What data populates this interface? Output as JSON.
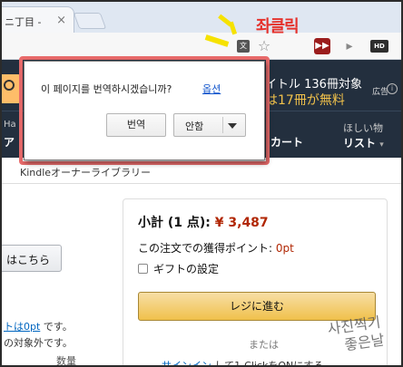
{
  "browser": {
    "tab_title": "ニ丁目 -",
    "tab_close": "×"
  },
  "annotation": {
    "label": "좌클릭"
  },
  "toolbar": {
    "translate_icon_glyph": "文",
    "star_glyph": "☆",
    "ext_glyph": "▶▶",
    "cursor_glyph": "▸",
    "hd_label": "HD"
  },
  "translate_popup": {
    "message": "이 페이지를 번역하시겠습니까?",
    "options_link": "옵션",
    "translate_button": "번역",
    "decline_button": "안함"
  },
  "amazon_header": {
    "promo_line1": "イトル 136冊対象",
    "promo_line2": "は17冊が無料",
    "ad_label": "広告",
    "ad_icon": "i",
    "nav_left_top": "Ha",
    "nav_left_bottom": "ア",
    "nav_cart": "カート",
    "nav_wishlist_top": "ほしい物",
    "nav_wishlist_bottom": "リスト",
    "nav_wishlist_caret": "▾"
  },
  "page": {
    "kindle_library": "Kindleオーナーライブラリー",
    "here_button": "はこちら",
    "left_link_text": "トは0pt",
    "left_link_suffix": " です。",
    "left_note": "の対象外です。",
    "left_qty": "数量"
  },
  "cart": {
    "subtotal_label": "小計 (1 点): ",
    "subtotal_price": "¥ 3,487",
    "points_label": "この注文での獲得ポイント: ",
    "points_value": "0pt",
    "gift_label": "ギフトの設定",
    "checkout_button": "レジに進む",
    "or_text": "または",
    "one_click_link": "サインイン",
    "one_click_suffix": " して1-ClickをONにする"
  },
  "watermark": {
    "line1": "사진찍기",
    "line2": "좋은날"
  },
  "colors": {
    "amazon_header": "#232f3e",
    "price_red": "#b12704",
    "checkout_yellow": "#f0c14b",
    "annotation_red": "#e5322c",
    "popup_outline": "#e96b6b",
    "link_blue": "#0066c0"
  }
}
